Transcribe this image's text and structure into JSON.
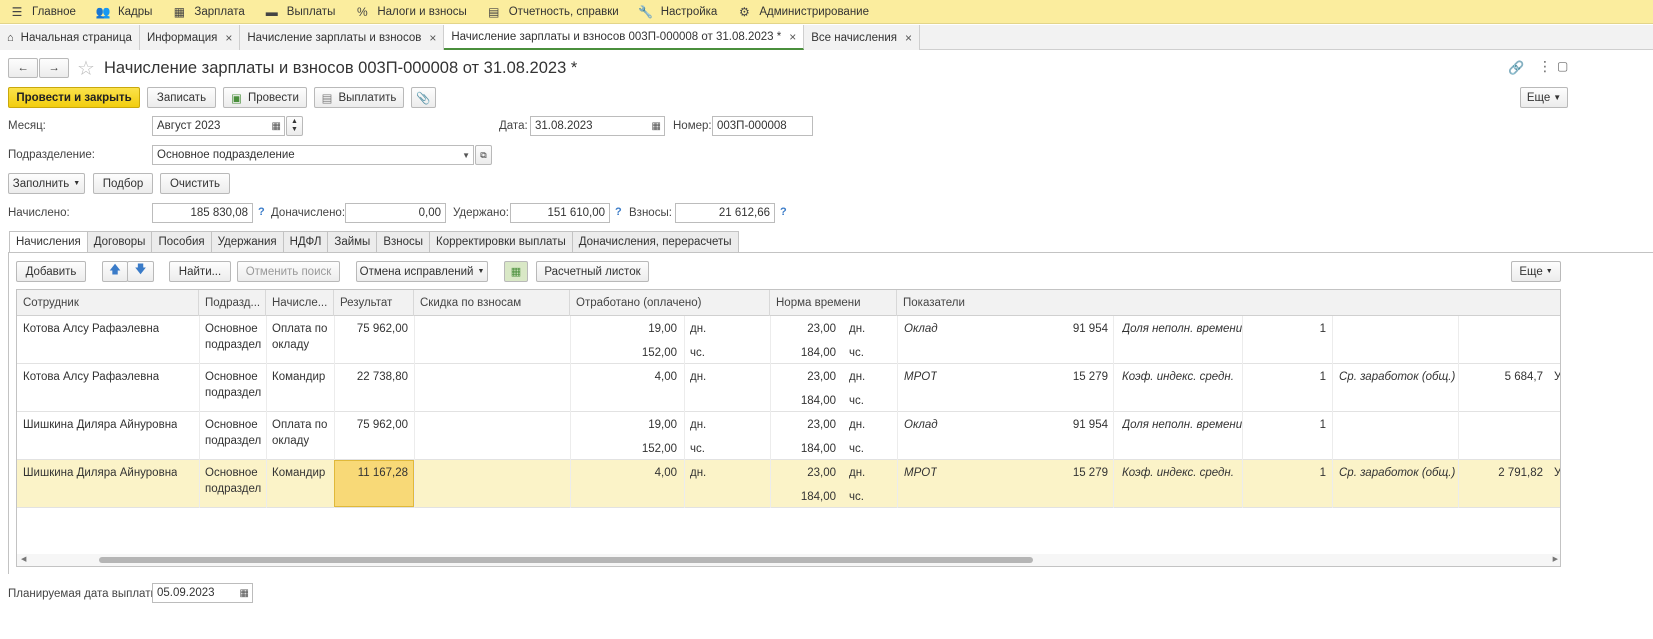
{
  "menu": [
    {
      "icon": "hamburger-icon",
      "glyph": "☰",
      "label": "Главное"
    },
    {
      "icon": "people-icon",
      "glyph": "👥",
      "label": "Кадры"
    },
    {
      "icon": "calculator-icon",
      "glyph": "▦",
      "label": "Зарплата"
    },
    {
      "icon": "wallet-icon",
      "glyph": "▬",
      "label": "Выплаты"
    },
    {
      "icon": "percent-icon",
      "glyph": "%",
      "label": "Налоги и взносы"
    },
    {
      "icon": "report-icon",
      "glyph": "▤",
      "label": "Отчетность, справки"
    },
    {
      "icon": "wrench-icon",
      "glyph": "🔧",
      "label": "Настройка"
    },
    {
      "icon": "gear-icon",
      "glyph": "⚙",
      "label": "Администрирование"
    }
  ],
  "window_tabs": [
    {
      "label": "Начальная страница",
      "home": true,
      "closable": false,
      "active": false
    },
    {
      "label": "Информация",
      "closable": true,
      "active": false
    },
    {
      "label": "Начисление зарплаты и взносов",
      "closable": true,
      "active": false
    },
    {
      "label": "Начисление зарплаты и взносов 003П-000008 от 31.08.2023 *",
      "closable": true,
      "active": true
    },
    {
      "label": "Все начисления",
      "closable": true,
      "active": false
    }
  ],
  "doc": {
    "title": "Начисление зарплаты и взносов 003П-000008 от 31.08.2023 *",
    "toolbar": {
      "post_close": "Провести и закрыть",
      "save": "Записать",
      "post": "Провести",
      "pay": "Выплатить",
      "more": "Еще"
    },
    "month_label": "Месяц:",
    "month_value": "Август 2023",
    "date_label": "Дата:",
    "date_value": "31.08.2023",
    "number_label": "Номер:",
    "number_value": "003П-000008",
    "division_label": "Подразделение:",
    "division_value": "Основное подразделение",
    "fill_button": "Заполнить",
    "select_button": "Подбор",
    "clear_button": "Очистить",
    "accrued_label": "Начислено:",
    "accrued_value": "185 830,08",
    "extra_label": "Доначислено:",
    "extra_value": "0,00",
    "withheld_label": "Удержано:",
    "withheld_value": "151 610,00",
    "contrib_label": "Взносы:",
    "contrib_value": "21 612,66",
    "help": "?",
    "planned_label": "Планируемая дата выплаты:",
    "planned_value": "05.09.2023"
  },
  "form_tabs": [
    "Начисления",
    "Договоры",
    "Пособия",
    "Удержания",
    "НДФЛ",
    "Займы",
    "Взносы",
    "Корректировки выплаты",
    "Доначисления, перерасчеты"
  ],
  "grid_toolbar": {
    "add": "Добавить",
    "find": "Найти...",
    "cancel_search": "Отменить поиск",
    "cancel_fix": "Отмена исправлений",
    "payslip": "Расчетный листок",
    "more": "Еще"
  },
  "columns": [
    "Сотрудник",
    "Подразд...",
    "Начисле...",
    "Результат",
    "Скидка по взносам",
    "Отработано (оплачено)",
    "Норма времени",
    "Показатели"
  ],
  "rows": [
    {
      "employee": "Котова Алсу Рафаэлевна",
      "division": [
        "Основное",
        "подраздел"
      ],
      "accrual": [
        "Оплата по",
        "окладу"
      ],
      "result": "75 962,00",
      "worked1": "19,00",
      "unit1": "дн.",
      "worked2": "152,00",
      "unit2": "чс.",
      "norm1": "23,00",
      "nunit1": "дн.",
      "norm2": "184,00",
      "nunit2": "чс.",
      "ind1": "Оклад",
      "val1": "91 954",
      "ind2": "Доля неполн. времени",
      "val2": "1",
      "ind3": "",
      "val3": "",
      "tail": "",
      "selected": false
    },
    {
      "employee": "Котова Алсу Рафаэлевна",
      "division": [
        "Основное",
        "подраздел"
      ],
      "accrual": [
        "Командир"
      ],
      "result": "22 738,80",
      "worked1": "4,00",
      "unit1": "дн.",
      "worked2": "",
      "unit2": "",
      "norm1": "23,00",
      "nunit1": "дн.",
      "norm2": "184,00",
      "nunit2": "чс.",
      "ind1": "МРОТ",
      "val1": "15 279",
      "ind2": "Коэф. индекс. средн.",
      "val2": "1",
      "ind3": "Ср. заработок (общ.)",
      "val3": "5 684,7",
      "tail": "У",
      "selected": false
    },
    {
      "employee": "Шишкина Диляра Айнуровна",
      "division": [
        "Основное",
        "подраздел"
      ],
      "accrual": [
        "Оплата по",
        "окладу"
      ],
      "result": "75 962,00",
      "worked1": "19,00",
      "unit1": "дн.",
      "worked2": "152,00",
      "unit2": "чс.",
      "norm1": "23,00",
      "nunit1": "дн.",
      "norm2": "184,00",
      "nunit2": "чс.",
      "ind1": "Оклад",
      "val1": "91 954",
      "ind2": "Доля неполн. времени",
      "val2": "1",
      "ind3": "",
      "val3": "",
      "tail": "",
      "selected": false
    },
    {
      "employee": "Шишкина Диляра Айнуровна",
      "division": [
        "Основное",
        "подраздел"
      ],
      "accrual": [
        "Командир"
      ],
      "result": "11 167,28",
      "worked1": "4,00",
      "unit1": "дн.",
      "worked2": "",
      "unit2": "",
      "norm1": "23,00",
      "nunit1": "дн.",
      "norm2": "184,00",
      "nunit2": "чс.",
      "ind1": "МРОТ",
      "val1": "15 279",
      "ind2": "Коэф. индекс. средн.",
      "val2": "1",
      "ind3": "Ср. заработок (общ.)",
      "val3": "2 791,82",
      "tail": "У",
      "selected": true
    }
  ]
}
